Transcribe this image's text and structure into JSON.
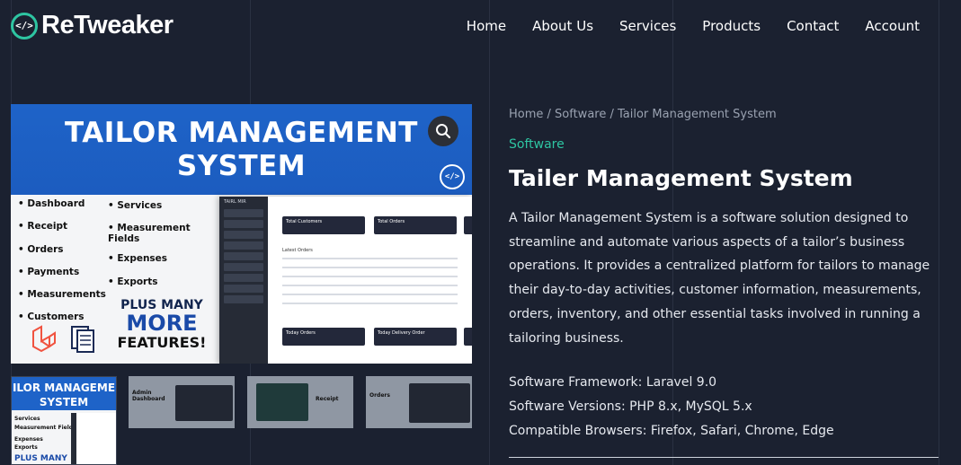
{
  "header": {
    "logo_text": "ReTweaker",
    "logo_mark": "</>",
    "nav": [
      "Home",
      "About Us",
      "Services",
      "Products",
      "Contact",
      "Account"
    ]
  },
  "gallery": {
    "main": {
      "title_line1": "TAILOR MANAGEMENT",
      "title_line2": "SYSTEM",
      "badge": "</>",
      "features_left": [
        "Dashboard",
        "Receipt",
        "Orders",
        "Payments",
        "Measurements",
        "Customers"
      ],
      "features_right": [
        "Services",
        "Measurement Fields",
        "Expenses",
        "Exports"
      ],
      "more_line1": "PLUS MANY",
      "more_line2": "MORE",
      "more_line3": "FEATURES!",
      "zoom_icon": "magnifier-icon",
      "screenshot": {
        "brand": "TAIRL MIR",
        "sidebar_items": [
          "Dashboard",
          "Orders",
          "Payments",
          "Measurements",
          "Customers",
          "Services",
          "Measurement Fields",
          "Expenses",
          "Exports",
          "Settings"
        ],
        "card_total_customers": "Total Customers",
        "card_total_orders": "Total Orders",
        "section_latest_orders": "Latest Orders",
        "card_today_orders": "Today Orders",
        "card_today_delivery": "Today Delivery Order"
      }
    },
    "thumbnails": [
      {
        "label_line1": "ILOR MANAGEME",
        "label_line2": "SYSTEM"
      },
      {
        "label": "Admin Dashboard"
      },
      {
        "label": "Receipt"
      },
      {
        "label": "Orders"
      }
    ]
  },
  "product": {
    "breadcrumb": "Home / Software / Tailor Management System",
    "category": "Software",
    "title": "Tailer Management System",
    "description": "A Tailor Management System is a software solution designed to streamline and automate various aspects of a tailor’s business operations. It provides a centralized platform for tailors to manage their day-to-day activities, customer information, measurements, orders, inventory, and other essential tasks involved in running a tailoring business.",
    "specs": [
      "Software Framework: Laravel 9.0",
      "Software Versions: PHP 8.x, MySQL 5.x",
      "Compatible Browsers: Firefox, Safari, Chrome, Edge"
    ]
  },
  "colors": {
    "background": "#1b2130",
    "accent": "#2ec5a2",
    "image_blue": "#1e63c8"
  }
}
